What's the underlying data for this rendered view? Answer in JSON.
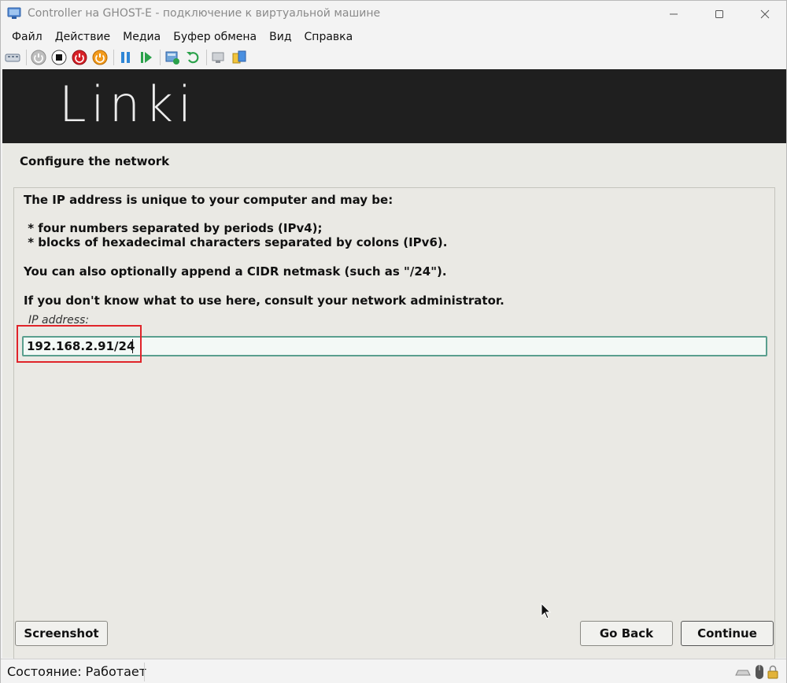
{
  "window": {
    "title": "Controller на GHOST-E - подключение к виртуальной машине"
  },
  "menu": {
    "items": [
      "Файл",
      "Действие",
      "Медиа",
      "Буфер обмена",
      "Вид",
      "Справка"
    ]
  },
  "toolbar": {
    "icons": [
      "ctrl-alt-del-icon",
      "start-icon",
      "turn-off-icon",
      "shutdown-icon",
      "power-icon",
      "pause-icon",
      "resume-icon",
      "checkpoint-icon",
      "revert-icon",
      "enhanced-session-icon",
      "share-icon"
    ]
  },
  "installer": {
    "banner_logo": "Linki",
    "section_title": "Configure the network",
    "line1": "The IP address is unique to your computer and may be:",
    "line2": " * four numbers separated by periods (IPv4);",
    "line3": " * blocks of hexadecimal characters separated by colons (IPv6).",
    "line4": "You can also optionally append a CIDR netmask (such as \"/24\").",
    "line5": "If you don't know what to use here, consult your network administrator.",
    "field_label": "IP address:",
    "ip_value": "192.168.2.91/24",
    "screenshot_label": "Screenshot",
    "goback_label": "Go Back",
    "continue_label": "Continue"
  },
  "statusbar": {
    "state": "Состояние: Работает"
  },
  "colors": {
    "highlight": "#e0242a",
    "input_border": "#5a9f8e",
    "banner": "#1f1f1f"
  }
}
